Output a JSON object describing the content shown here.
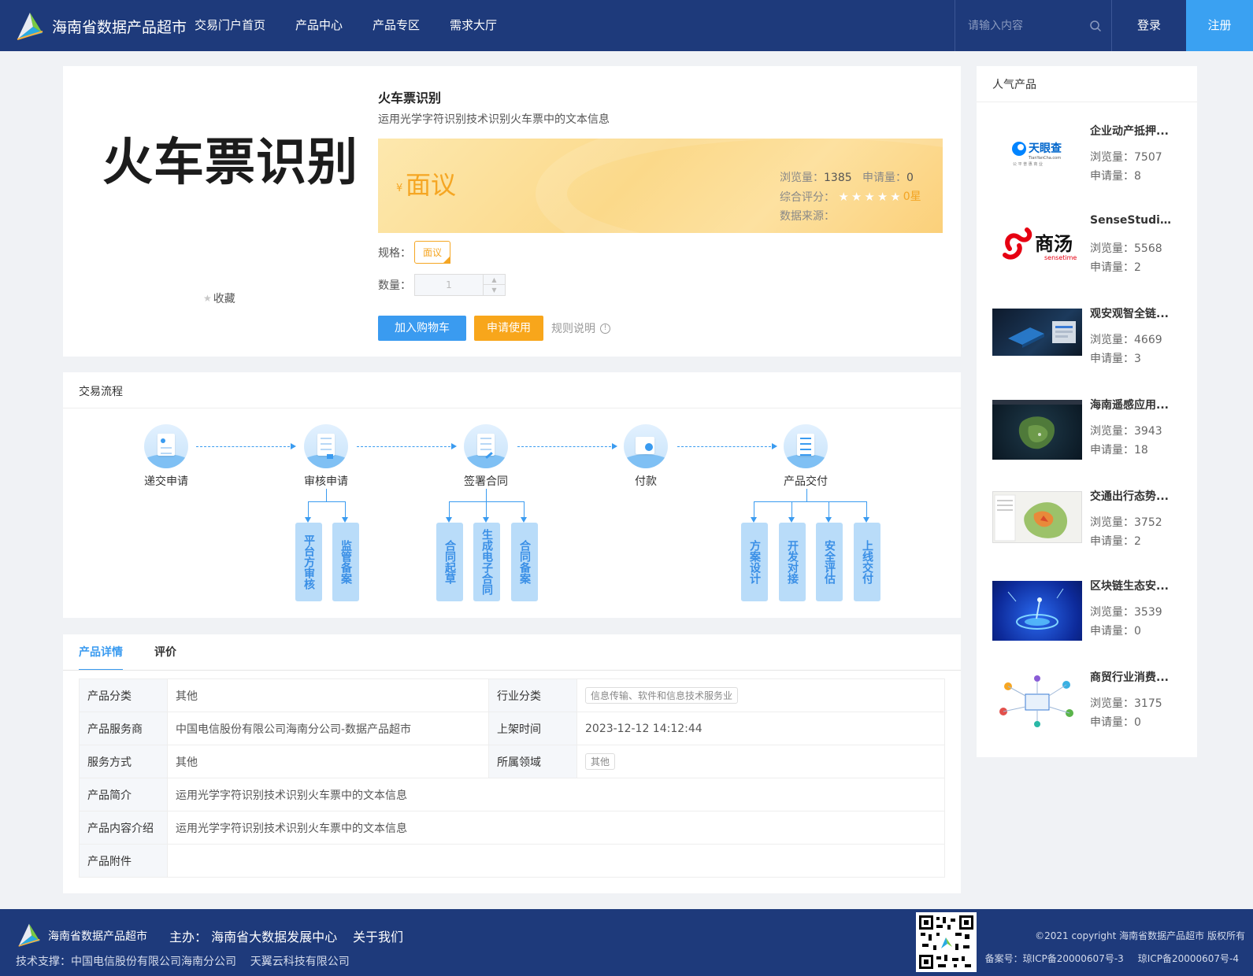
{
  "header": {
    "site_title": "海南省数据产品超市",
    "nav": [
      "交易门户首页",
      "产品中心",
      "产品专区",
      "需求大厅"
    ],
    "search_placeholder": "请输入内容",
    "login": "登录",
    "register": "注册"
  },
  "product": {
    "image_text": "火车票识别",
    "favorite": "收藏",
    "title": "火车票识别",
    "description": "运用光学字符识别技术识别火车票中的文本信息",
    "currency": "¥",
    "price": "面议",
    "views_label": "浏览量：",
    "views": "1385",
    "applications_label": "申请量：",
    "applications": "0",
    "rating_label": "综合评分：",
    "rating": "0星",
    "stars_total": 5,
    "stars_filled": 0,
    "source_label": "数据来源：",
    "spec_label": "规格：",
    "spec_value": "面议",
    "qty_label": "数量：",
    "qty_value": "1",
    "add_cart": "加入购物车",
    "apply": "申请使用",
    "rules": "规则说明"
  },
  "sidebar": {
    "title": "人气产品",
    "items": [
      {
        "name": "企业动产抵押...",
        "views": "浏览量：7507",
        "apps": "申请量：8",
        "thumb": "tianyancha-logo",
        "thumb_text": "天眼查",
        "thumb_sub": "TianYanCha.com",
        "thumb_tag": "公 平 普 惠 商 业"
      },
      {
        "name": "SenseStudio...",
        "views": "浏览量：5568",
        "apps": "申请量：2",
        "thumb": "sensetime-logo",
        "thumb_text": "商汤",
        "thumb_sub": "sensetime"
      },
      {
        "name": "观安观智全链...",
        "views": "浏览量：4669",
        "apps": "申请量：3",
        "thumb": "dashboard-image"
      },
      {
        "name": "海南遥感应用...",
        "views": "浏览量：3943",
        "apps": "申请量：18",
        "thumb": "satellite-map-image"
      },
      {
        "name": "交通出行态势...",
        "views": "浏览量：3752",
        "apps": "申请量：2",
        "thumb": "traffic-map-image"
      },
      {
        "name": "区块链生态安...",
        "views": "浏览量：3539",
        "apps": "申请量：0",
        "thumb": "blockchain-image"
      },
      {
        "name": "商贸行业消费...",
        "views": "浏览量：3175",
        "apps": "申请量：0",
        "thumb": "network-diagram-image"
      }
    ]
  },
  "flow": {
    "title": "交易流程",
    "steps": [
      "递交申请",
      "审核申请",
      "签署合同",
      "付款",
      "产品交付"
    ],
    "review_subs": [
      "平台方审核",
      "监管备案"
    ],
    "contract_subs": [
      "合同起草",
      "生成电子合同",
      "合同备案"
    ],
    "delivery_subs": [
      "方案设计",
      "开发对接",
      "安全评估",
      "上线交付"
    ]
  },
  "details": {
    "tabs": [
      "产品详情",
      "评价"
    ],
    "rows": {
      "category_k": "产品分类",
      "category_v": "其他",
      "industry_k": "行业分类",
      "industry_v": "信息传输、软件和信息技术服务业",
      "provider_k": "产品服务商",
      "provider_v": "中国电信股份有限公司海南分公司-数据产品超市",
      "listed_k": "上架时间",
      "listed_v": "2023-12-12 14:12:44",
      "service_k": "服务方式",
      "service_v": "其他",
      "domain_k": "所属领域",
      "domain_v": "其他",
      "intro_k": "产品简介",
      "intro_v": "运用光学字符识别技术识别火车票中的文本信息",
      "content_k": "产品内容介绍",
      "content_v": "运用光学字符识别技术识别火车票中的文本信息",
      "attach_k": "产品附件",
      "attach_v": ""
    }
  },
  "footer": {
    "site": "海南省数据产品超市",
    "host": "主办： 海南省大数据发展中心",
    "about": "关于我们",
    "tech": "技术支撑：中国电信股份有限公司海南分公司    天翼云科技有限公司",
    "copyright": "©2021 copyright 海南省数据产品超市 版权所有",
    "icp1": "备案号：琼ICP备20000607号-3",
    "icp2": "琼ICP备20000607号-4"
  },
  "colors": {
    "header_bg": "#1e3a7b",
    "accent_blue": "#3a9bf0",
    "accent_orange": "#f5a623"
  }
}
